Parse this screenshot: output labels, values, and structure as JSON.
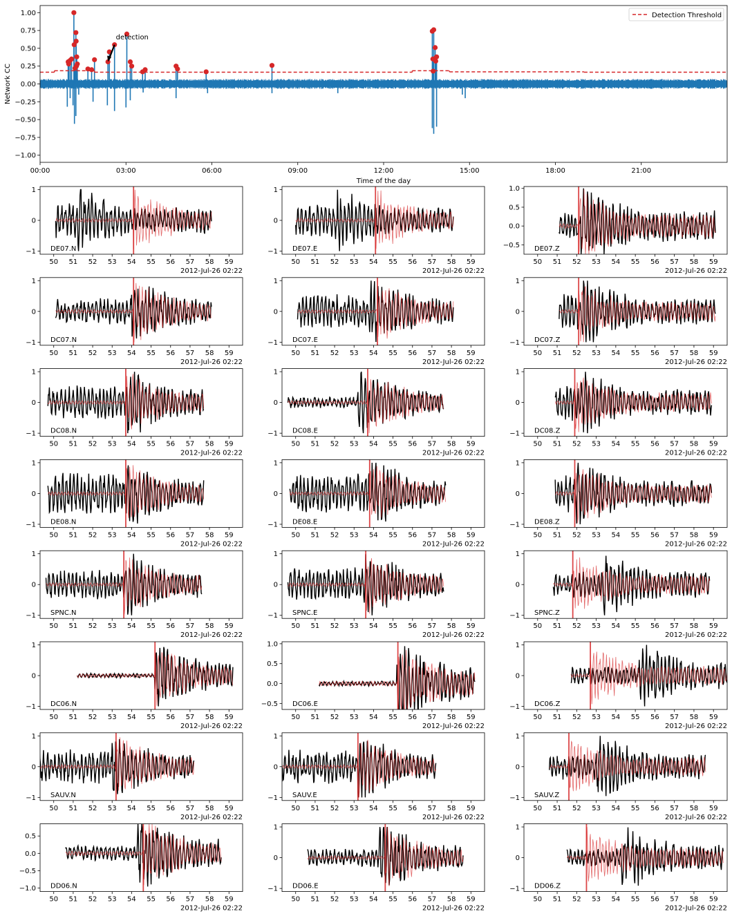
{
  "chart_data": [
    {
      "type": "line",
      "name": "network-cc",
      "xlabel": "Time of the day",
      "ylabel": "Network CC",
      "xlim_hours": [
        0,
        24
      ],
      "ylim": [
        -1.1,
        1.1
      ],
      "xticks": [
        {
          "v": 0,
          "label": "00:00"
        },
        {
          "v": 3,
          "label": "03:00"
        },
        {
          "v": 6,
          "label": "06:00"
        },
        {
          "v": 9,
          "label": "09:00"
        },
        {
          "v": 12,
          "label": "12:00"
        },
        {
          "v": 15,
          "label": "15:00"
        },
        {
          "v": 18,
          "label": "18:00"
        },
        {
          "v": 21,
          "label": "21:00"
        }
      ],
      "yticks": [
        {
          "v": 1.0,
          "label": "1.00"
        },
        {
          "v": 0.75,
          "label": "0.75"
        },
        {
          "v": 0.5,
          "label": "0.50"
        },
        {
          "v": 0.25,
          "label": "0.25"
        },
        {
          "v": 0.0,
          "label": "0.00"
        },
        {
          "v": -0.25,
          "label": "−0.25"
        },
        {
          "v": -0.5,
          "label": "−0.50"
        },
        {
          "v": -0.75,
          "label": "−0.75"
        },
        {
          "v": -1.0,
          "label": "−1.00"
        }
      ],
      "legend": {
        "label": "Detection Threshold",
        "placement": "top-right"
      },
      "colors": {
        "cc": "#1f77b4",
        "threshold": "#d62728",
        "detections": "#d62728"
      },
      "noise_band": 0.06,
      "threshold_segments": [
        {
          "x": [
            0,
            0.5
          ],
          "y": 0.165
        },
        {
          "x": [
            0.5,
            1.9
          ],
          "y": 0.185
        },
        {
          "x": [
            1.9,
            13.0
          ],
          "y": 0.165
        },
        {
          "x": [
            13.0,
            14.3
          ],
          "y": 0.185
        },
        {
          "x": [
            14.3,
            19.0
          ],
          "y": 0.17
        },
        {
          "x": [
            19.0,
            24
          ],
          "y": 0.165
        }
      ],
      "detections": [
        {
          "t": 0.98,
          "cc": 0.31
        },
        {
          "t": 1.0,
          "cc": 0.28
        },
        {
          "t": 1.05,
          "cc": 0.33
        },
        {
          "t": 1.1,
          "cc": 0.35
        },
        {
          "t": 1.18,
          "cc": 1.0
        },
        {
          "t": 1.19,
          "cc": 0.55
        },
        {
          "t": 1.22,
          "cc": 0.22
        },
        {
          "t": 1.25,
          "cc": 0.72
        },
        {
          "t": 1.26,
          "cc": 0.6
        },
        {
          "t": 1.28,
          "cc": 0.38
        },
        {
          "t": 1.3,
          "cc": 0.28
        },
        {
          "t": 1.27,
          "cc": 0.25
        },
        {
          "t": 1.67,
          "cc": 0.21
        },
        {
          "t": 1.8,
          "cc": 0.2
        },
        {
          "t": 1.9,
          "cc": 0.34
        },
        {
          "t": 2.37,
          "cc": 0.31
        },
        {
          "t": 2.42,
          "cc": 0.45
        },
        {
          "t": 2.6,
          "cc": 0.55
        },
        {
          "t": 3.03,
          "cc": 0.7
        },
        {
          "t": 3.15,
          "cc": 0.31
        },
        {
          "t": 3.2,
          "cc": 0.25
        },
        {
          "t": 3.58,
          "cc": 0.17
        },
        {
          "t": 3.67,
          "cc": 0.2
        },
        {
          "t": 4.75,
          "cc": 0.25
        },
        {
          "t": 4.8,
          "cc": 0.21
        },
        {
          "t": 5.8,
          "cc": 0.17
        },
        {
          "t": 8.1,
          "cc": 0.26
        },
        {
          "t": 13.7,
          "cc": 0.74
        },
        {
          "t": 13.75,
          "cc": 0.76
        },
        {
          "t": 13.8,
          "cc": 0.51
        },
        {
          "t": 13.72,
          "cc": 0.35
        },
        {
          "t": 13.85,
          "cc": 0.38
        },
        {
          "t": 13.82,
          "cc": 0.32
        },
        {
          "t": 13.73,
          "cc": 0.18
        }
      ],
      "spikes": [
        {
          "t": 0.95,
          "lo": -0.32
        },
        {
          "t": 1.05,
          "lo": -0.2
        },
        {
          "t": 1.15,
          "lo": -0.3
        },
        {
          "t": 1.2,
          "lo": -0.56
        },
        {
          "t": 1.25,
          "lo": -0.45
        },
        {
          "t": 1.35,
          "lo": -0.15
        },
        {
          "t": 1.85,
          "lo": -0.25
        },
        {
          "t": 2.35,
          "lo": -0.3
        },
        {
          "t": 2.6,
          "lo": -0.38
        },
        {
          "t": 3.0,
          "lo": -0.33
        },
        {
          "t": 3.15,
          "lo": -0.23
        },
        {
          "t": 3.6,
          "lo": -0.12
        },
        {
          "t": 4.75,
          "lo": -0.2
        },
        {
          "t": 5.85,
          "lo": -0.13
        },
        {
          "t": 8.1,
          "lo": -0.13
        },
        {
          "t": 10.4,
          "lo": -0.13
        },
        {
          "t": 13.7,
          "lo": -0.62
        },
        {
          "t": 13.75,
          "lo": -0.7
        },
        {
          "t": 13.85,
          "lo": -0.6
        },
        {
          "t": 14.75,
          "lo": -0.15
        },
        {
          "t": 14.85,
          "lo": -0.2
        }
      ],
      "annotation": {
        "text": "detection",
        "from": {
          "t": 2.6,
          "cc": 0.55
        },
        "to": {
          "t": 2.37,
          "cc": 0.31
        }
      }
    },
    {
      "type": "line",
      "name": "waveform-grid",
      "x_axis_unit": "seconds after 2012-Jul-26 02:22",
      "xlim": [
        49.3,
        59.7
      ],
      "xticks": [
        50,
        51,
        52,
        53,
        54,
        55,
        56,
        57,
        58,
        59
      ],
      "offset_label": "2012-Jul-26 02:22",
      "colors": {
        "data": "#000000",
        "template": "#d62728",
        "pick": "#d62728"
      },
      "panels": [
        {
          "label": "DE07.N",
          "start": 50.1,
          "end": 58.1,
          "pick": 54.1,
          "ylim": [
            -1.1,
            1.1
          ],
          "yticks": [
            {
              "v": 1,
              "label": "1"
            },
            {
              "v": 0,
              "label": "0"
            },
            {
              "v": -1,
              "label": "−1"
            }
          ],
          "amp": 0.5,
          "onset": 51.2,
          "seed": 1
        },
        {
          "label": "DE07.E",
          "start": 50.0,
          "end": 58.1,
          "pick": 54.1,
          "ylim": [
            -1.1,
            1.1
          ],
          "yticks": [
            {
              "v": 1,
              "label": "1"
            },
            {
              "v": 0,
              "label": "0"
            },
            {
              "v": -1,
              "label": "−1"
            }
          ],
          "amp": 0.45,
          "onset": 52.0,
          "seed": 2
        },
        {
          "label": "DE07.Z",
          "start": 51.1,
          "end": 59.1,
          "pick": 52.1,
          "ylim": [
            -0.75,
            1.05
          ],
          "yticks": [
            {
              "v": 1,
              "label": "1.0"
            },
            {
              "v": 0.5,
              "label": "0.5"
            },
            {
              "v": 0,
              "label": "0.0"
            },
            {
              "v": -0.5,
              "label": "−0.5"
            }
          ],
          "amp": 0.3,
          "onset": 52.2,
          "seed": 3
        },
        {
          "label": "DC07.N",
          "start": 50.1,
          "end": 58.1,
          "pick": 54.1,
          "ylim": [
            -1.1,
            1.1
          ],
          "yticks": [
            {
              "v": 1,
              "label": "1"
            },
            {
              "v": 0,
              "label": "0"
            },
            {
              "v": -1,
              "label": "−1"
            }
          ],
          "amp": 0.35,
          "onset": 53.9,
          "seed": 4
        },
        {
          "label": "DC07.E",
          "start": 50.1,
          "end": 58.1,
          "pick": 54.2,
          "ylim": [
            -1.1,
            1.1
          ],
          "yticks": [
            {
              "v": 1,
              "label": "1"
            },
            {
              "v": 0,
              "label": "0"
            },
            {
              "v": -1,
              "label": "−1"
            }
          ],
          "amp": 0.45,
          "onset": 53.8,
          "seed": 5
        },
        {
          "label": "DC07.Z",
          "start": 51.1,
          "end": 59.1,
          "pick": 52.1,
          "ylim": [
            -1.1,
            1.1
          ],
          "yticks": [
            {
              "v": 1,
              "label": "1"
            },
            {
              "v": 0,
              "label": "0"
            },
            {
              "v": -1,
              "label": "−1"
            }
          ],
          "amp": 0.55,
          "onset": 52.3,
          "seed": 6
        },
        {
          "label": "DC08.N",
          "start": 49.7,
          "end": 57.7,
          "pick": 53.7,
          "ylim": [
            -1.1,
            1.1
          ],
          "yticks": [
            {
              "v": 1,
              "label": "1"
            },
            {
              "v": 0,
              "label": "0"
            },
            {
              "v": -1,
              "label": "−1"
            }
          ],
          "amp": 0.45,
          "onset": 53.8,
          "seed": 7
        },
        {
          "label": "DC08.E",
          "start": 49.6,
          "end": 57.6,
          "pick": 53.7,
          "ylim": [
            -1.1,
            1.1
          ],
          "yticks": [
            {
              "v": 1,
              "label": "1"
            },
            {
              "v": 0,
              "label": "0"
            },
            {
              "v": -1,
              "label": "−1"
            }
          ],
          "amp": 0.15,
          "onset": 53.2,
          "seed": 8
        },
        {
          "label": "DC08.Z",
          "start": 50.9,
          "end": 58.9,
          "pick": 51.9,
          "ylim": [
            -1.1,
            1.1
          ],
          "yticks": [
            {
              "v": 1,
              "label": "1"
            },
            {
              "v": 0,
              "label": "0"
            },
            {
              "v": -1,
              "label": "−1"
            }
          ],
          "amp": 0.5,
          "onset": 52.0,
          "seed": 9
        },
        {
          "label": "DE08.N",
          "start": 49.7,
          "end": 57.7,
          "pick": 53.7,
          "ylim": [
            -1.1,
            1.1
          ],
          "yticks": [
            {
              "v": 1,
              "label": "1"
            },
            {
              "v": 0,
              "label": "0"
            },
            {
              "v": -1,
              "label": "−1"
            }
          ],
          "amp": 0.55,
          "onset": 53.7,
          "seed": 10
        },
        {
          "label": "DE08.E",
          "start": 49.7,
          "end": 57.7,
          "pick": 53.8,
          "ylim": [
            -1.1,
            1.1
          ],
          "yticks": [
            {
              "v": 1,
              "label": "1"
            },
            {
              "v": 0,
              "label": "0"
            },
            {
              "v": -1,
              "label": "−1"
            }
          ],
          "amp": 0.55,
          "onset": 53.9,
          "seed": 11
        },
        {
          "label": "DE08.Z",
          "start": 50.9,
          "end": 58.9,
          "pick": 51.9,
          "ylim": [
            -1.1,
            1.1
          ],
          "yticks": [
            {
              "v": 1,
              "label": "1"
            },
            {
              "v": 0,
              "label": "0"
            },
            {
              "v": -1,
              "label": "−1"
            }
          ],
          "amp": 0.5,
          "onset": 52.0,
          "seed": 12
        },
        {
          "label": "SPNC.N",
          "start": 49.6,
          "end": 57.6,
          "pick": 53.6,
          "ylim": [
            -1.1,
            1.1
          ],
          "yticks": [
            {
              "v": 1,
              "label": "1"
            },
            {
              "v": 0,
              "label": "0"
            },
            {
              "v": -1,
              "label": "−1"
            }
          ],
          "amp": 0.4,
          "onset": 53.8,
          "seed": 13
        },
        {
          "label": "SPNC.E",
          "start": 49.6,
          "end": 57.6,
          "pick": 53.6,
          "ylim": [
            -1.1,
            1.1
          ],
          "yticks": [
            {
              "v": 1,
              "label": "1"
            },
            {
              "v": 0,
              "label": "0"
            },
            {
              "v": -1,
              "label": "−1"
            }
          ],
          "amp": 0.45,
          "onset": 53.5,
          "seed": 14
        },
        {
          "label": "SPNC.Z",
          "start": 50.8,
          "end": 58.8,
          "pick": 51.8,
          "ylim": [
            -1.1,
            1.1
          ],
          "yticks": [
            {
              "v": 1,
              "label": "1"
            },
            {
              "v": 0,
              "label": "0"
            },
            {
              "v": -1,
              "label": "−1"
            }
          ],
          "amp": 0.35,
          "onset": 53.2,
          "seed": 15
        },
        {
          "label": "DC06.N",
          "start": 51.2,
          "end": 59.2,
          "pick": 55.2,
          "ylim": [
            -1.1,
            1.1
          ],
          "yticks": [
            {
              "v": 1,
              "label": "1"
            },
            {
              "v": 0,
              "label": "0"
            },
            {
              "v": -1,
              "label": "−1"
            }
          ],
          "amp": 0.06,
          "onset": 55.2,
          "seed": 16
        },
        {
          "label": "DC06.E",
          "start": 51.2,
          "end": 59.2,
          "pick": 55.25,
          "ylim": [
            -0.65,
            1.05
          ],
          "yticks": [
            {
              "v": 1,
              "label": "1.0"
            },
            {
              "v": 0.5,
              "label": "0.5"
            },
            {
              "v": 0,
              "label": "0.0"
            },
            {
              "v": -0.5,
              "label": "−0.5"
            }
          ],
          "amp": 0.05,
          "onset": 55.2,
          "seed": 17
        },
        {
          "label": "DC06.Z",
          "start": 51.7,
          "end": 59.7,
          "pick": 52.7,
          "ylim": [
            -1.1,
            1.1
          ],
          "yticks": [
            {
              "v": 1,
              "label": "1"
            },
            {
              "v": 0,
              "label": "0"
            },
            {
              "v": -1,
              "label": "−1"
            }
          ],
          "amp": 0.25,
          "onset": 55.2,
          "seed": 18
        },
        {
          "label": "SAUV.N",
          "start": 49.2,
          "end": 57.2,
          "pick": 53.2,
          "ylim": [
            -1.1,
            1.1
          ],
          "yticks": [
            {
              "v": 1,
              "label": "1"
            },
            {
              "v": 0,
              "label": "0"
            },
            {
              "v": -1,
              "label": "−1"
            }
          ],
          "amp": 0.45,
          "onset": 53.0,
          "seed": 19
        },
        {
          "label": "SAUV.E",
          "start": 49.2,
          "end": 57.2,
          "pick": 53.2,
          "ylim": [
            -1.1,
            1.1
          ],
          "yticks": [
            {
              "v": 1,
              "label": "1"
            },
            {
              "v": 0,
              "label": "0"
            },
            {
              "v": -1,
              "label": "−1"
            }
          ],
          "amp": 0.45,
          "onset": 53.2,
          "seed": 20
        },
        {
          "label": "SAUV.Z",
          "start": 50.6,
          "end": 58.6,
          "pick": 51.6,
          "ylim": [
            -1.1,
            1.1
          ],
          "yticks": [
            {
              "v": 1,
              "label": "1"
            },
            {
              "v": 0,
              "label": "0"
            },
            {
              "v": -1,
              "label": "−1"
            }
          ],
          "amp": 0.35,
          "onset": 53.0,
          "seed": 21
        },
        {
          "label": "DD06.N",
          "start": 50.6,
          "end": 58.6,
          "pick": 54.6,
          "ylim": [
            -1.1,
            0.85
          ],
          "yticks": [
            {
              "v": 0.5,
              "label": "0.5"
            },
            {
              "v": 0,
              "label": "0.0"
            },
            {
              "v": -0.5,
              "label": "−0.5"
            },
            {
              "v": -1,
              "label": "−1.0"
            }
          ],
          "amp": 0.18,
          "onset": 54.3,
          "seed": 22
        },
        {
          "label": "DD06.E",
          "start": 50.6,
          "end": 58.6,
          "pick": 54.6,
          "ylim": [
            -1.1,
            1.1
          ],
          "yticks": [
            {
              "v": 1,
              "label": "1"
            },
            {
              "v": 0,
              "label": "0"
            },
            {
              "v": -1,
              "label": "−1"
            }
          ],
          "amp": 0.25,
          "onset": 54.3,
          "seed": 23
        },
        {
          "label": "DD06.Z",
          "start": 51.5,
          "end": 59.5,
          "pick": 52.5,
          "ylim": [
            -1.1,
            1.1
          ],
          "yticks": [
            {
              "v": 1,
              "label": "1"
            },
            {
              "v": 0,
              "label": "0"
            },
            {
              "v": -1,
              "label": "−1"
            }
          ],
          "amp": 0.25,
          "onset": 54.3,
          "seed": 24
        }
      ]
    }
  ]
}
